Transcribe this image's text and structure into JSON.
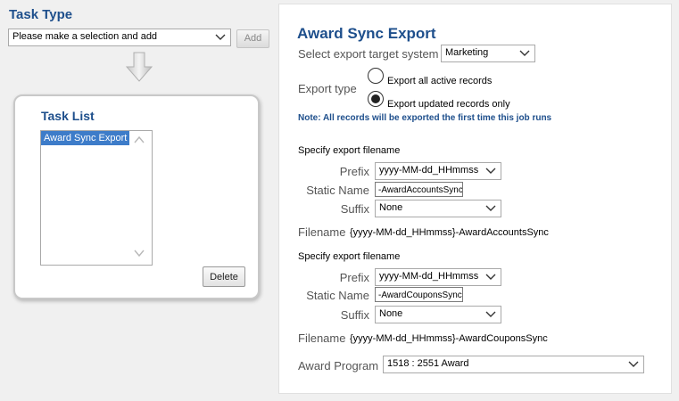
{
  "task_type": {
    "title": "Task Type",
    "select_value": "Please make a selection and add",
    "add_label": "Add"
  },
  "task_list": {
    "title": "Task List",
    "items": [
      "Award Sync Export"
    ],
    "delete_label": "Delete"
  },
  "export": {
    "title": "Award Sync Export",
    "target_label": "Select export target system",
    "target_value": "Marketing",
    "type_label": "Export type",
    "option_all": "Export all active records",
    "option_updated": "Export updated records only",
    "selected_option": "updated",
    "note": "Note: All records will be exported the first time this job runs"
  },
  "filename_blocks": [
    {
      "heading": "Specify export filename",
      "prefix_label": "Prefix",
      "prefix_value": "yyyy-MM-dd_HHmmss",
      "static_label": "Static Name",
      "static_value": "-AwardAccountsSync",
      "suffix_label": "Suffix",
      "suffix_value": "None",
      "filename_label": "Filename",
      "filename_value": "{yyyy-MM-dd_HHmmss}-AwardAccountsSync"
    },
    {
      "heading": "Specify export filename",
      "prefix_label": "Prefix",
      "prefix_value": "yyyy-MM-dd_HHmmss",
      "static_label": "Static Name",
      "static_value": "-AwardCouponsSync",
      "suffix_label": "Suffix",
      "suffix_value": "None",
      "filename_label": "Filename",
      "filename_value": "{yyyy-MM-dd_HHmmss}-AwardCouponsSync"
    }
  ],
  "award_program": {
    "label": "Award Program",
    "value": "1518 : 2551 Award"
  },
  "icons": [
    "chevron-down-icon",
    "down-arrow-icon",
    "scroll-up-icon",
    "scroll-down-icon"
  ],
  "colors": {
    "heading_blue": "#1e4f8c",
    "selection_blue": "#3d7cc9",
    "panel_bg": "#f0f0f0"
  }
}
